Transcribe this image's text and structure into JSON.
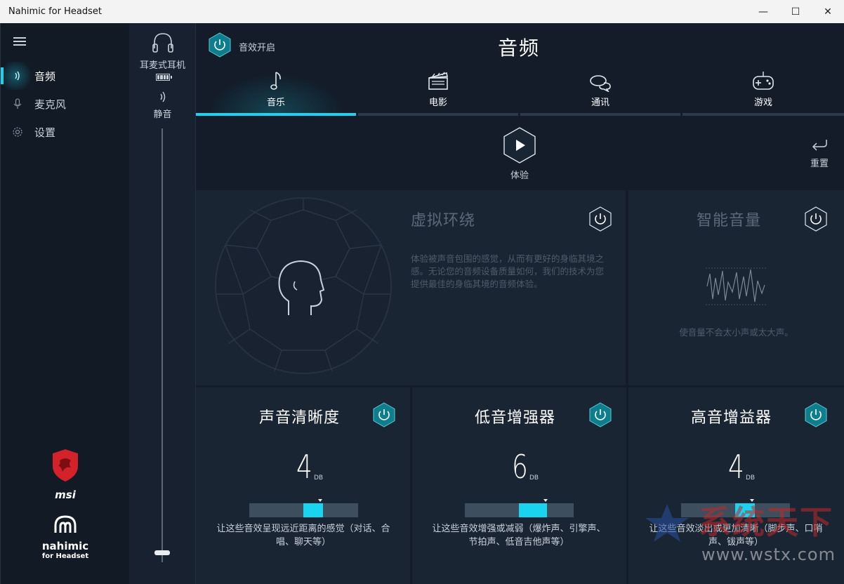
{
  "window": {
    "title": "Nahimic for Headset",
    "minimize": "—",
    "maximize": "☐",
    "close": "✕"
  },
  "sidebar": {
    "items": [
      {
        "label": "音频",
        "icon": "sound-icon",
        "active": true
      },
      {
        "label": "麦克风",
        "icon": "microphone-icon",
        "active": false
      },
      {
        "label": "设置",
        "icon": "gear-icon",
        "active": false
      }
    ],
    "brand_msi": "msi",
    "brand_nahimic": "nahimic",
    "brand_nahimic_sub": "for Headset"
  },
  "device": {
    "name": "耳麦式耳机",
    "mute_label": "静音",
    "volume_percent": 2
  },
  "header": {
    "effects_toggle_label": "音效开启",
    "title": "音频"
  },
  "tabs": [
    {
      "label": "音乐",
      "icon": "music-note-icon",
      "active": true
    },
    {
      "label": "电影",
      "icon": "clapperboard-icon",
      "active": false
    },
    {
      "label": "通讯",
      "icon": "chat-bubbles-icon",
      "active": false
    },
    {
      "label": "游戏",
      "icon": "gamepad-icon",
      "active": false
    }
  ],
  "experience": {
    "label": "体验"
  },
  "reset": {
    "label": "重置"
  },
  "panels": {
    "surround": {
      "title": "虚拟环绕",
      "desc": "体验被声音包围的感觉，从而有更好的身临其境之感。无论您的音频设备质量如何，我们的技术为您提供最佳的身临其境的音频体验。",
      "enabled": false
    },
    "smart_volume": {
      "title": "智能音量",
      "desc": "使音量不会太小声或太大声。",
      "enabled": false
    }
  },
  "controls": [
    {
      "title": "声音清晰度",
      "value": "4",
      "unit": "DB",
      "level": 0.5,
      "desc": "让这些音效呈现远近距离的感觉（对话、合唱、聊天等）"
    },
    {
      "title": "低音增强器",
      "value": "6",
      "unit": "DB",
      "level": 0.6,
      "desc": "让这些音效增强或减弱（爆炸声、引擎声、节拍声、低音吉他声等）"
    },
    {
      "title": "高音增益器",
      "value": "4",
      "unit": "DB",
      "level": 0.5,
      "desc": "让这些音效淡出或更加清晰（脚步声、口哨声、钹声等）"
    }
  ],
  "watermark": {
    "text_cn": "系统天下",
    "text_url": "www.wstx.com"
  },
  "colors": {
    "accent": "#19d3ef",
    "hex_button": "#0e7e8c",
    "background": "#131c28"
  }
}
